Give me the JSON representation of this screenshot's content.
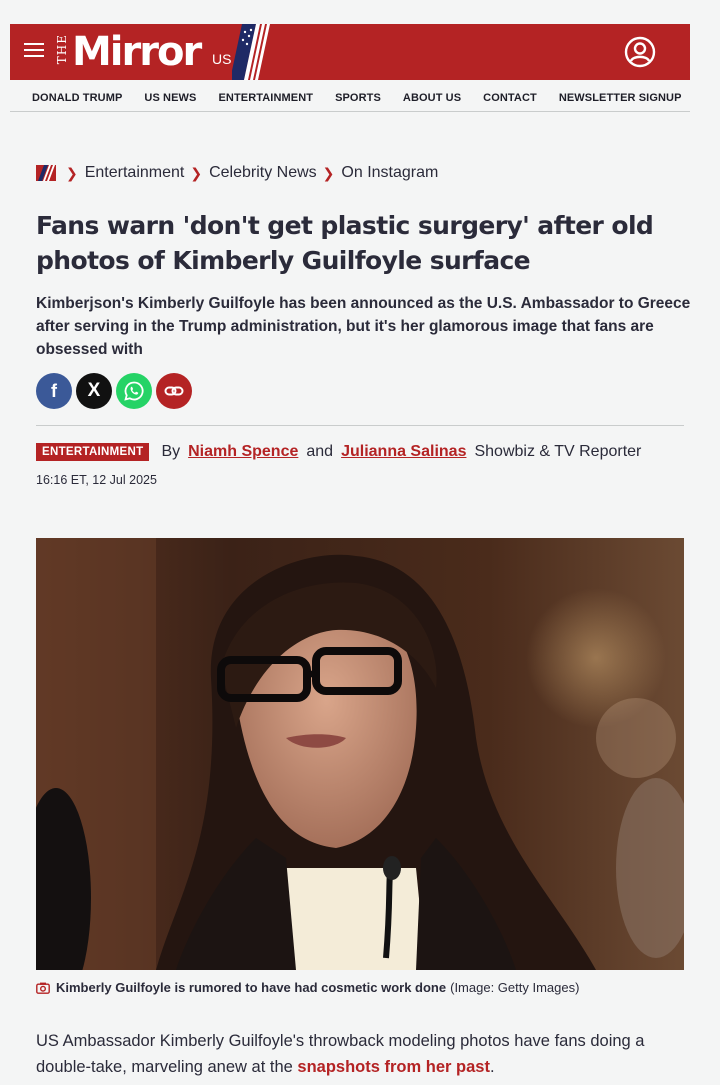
{
  "masthead": {
    "logo_the": "THE",
    "logo_name": "Mirror",
    "logo_edition": "US",
    "bg_color": "#b42324"
  },
  "nav": {
    "items": [
      "DONALD TRUMP",
      "US NEWS",
      "ENTERTAINMENT",
      "SPORTS",
      "ABOUT US",
      "CONTACT",
      "NEWSLETTER SIGNUP"
    ]
  },
  "breadcrumb": {
    "items": [
      "Entertainment",
      "Celebrity News",
      "On Instagram"
    ]
  },
  "article": {
    "headline": "Fans warn 'don't get plastic surgery' after old photos of Kimberly Guilfoyle surface",
    "standfirst": "Kimberjson's Kimberly Guilfoyle has been announced as the U.S. Ambassador to Greece after serving in the Trump administration, but it's her glamorous image that fans are obsessed with",
    "tag": "ENTERTAINMENT",
    "by": "By",
    "author1": "Niamh Spence",
    "and": "and",
    "author2": "Julianna Salinas",
    "role": "Showbiz & TV Reporter",
    "timestamp": "16:16 ET, 12 Jul 2025",
    "caption": "Kimberly Guilfoyle is rumored to have had cosmetic work done",
    "credit": "(Image: Getty Images)",
    "body_start": "US Ambassador Kimberly Guilfoyle's throwback modeling photos have fans doing a double-take, marveling anew at the ",
    "body_link": "snapshots from her past",
    "body_end": "."
  },
  "share": {
    "icons": [
      "facebook-icon",
      "x-icon",
      "whatsapp-icon",
      "link-icon"
    ],
    "facebook_glyph": "f",
    "x_glyph": "X"
  }
}
